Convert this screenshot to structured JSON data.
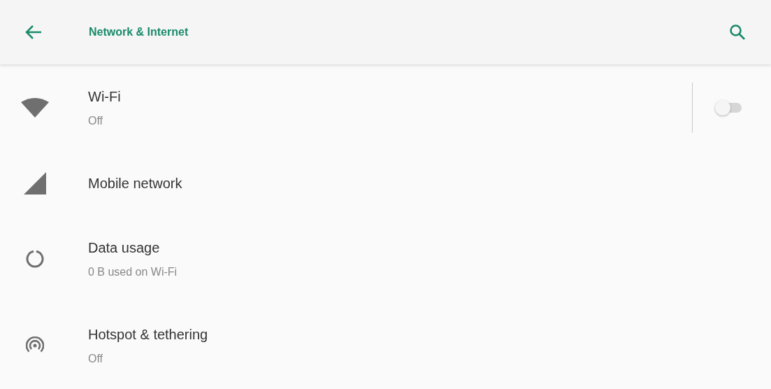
{
  "app_bar": {
    "title": "Network & Internet"
  },
  "items": [
    {
      "kind": "wifi",
      "title": "Wi-Fi",
      "summary": "Off",
      "toggle": {
        "on": false
      }
    },
    {
      "kind": "mobile",
      "title": "Mobile network"
    },
    {
      "kind": "data",
      "title": "Data usage",
      "summary": "0 B used on Wi-Fi"
    },
    {
      "kind": "hotspot",
      "title": "Hotspot & tethering",
      "summary": "Off"
    }
  ]
}
